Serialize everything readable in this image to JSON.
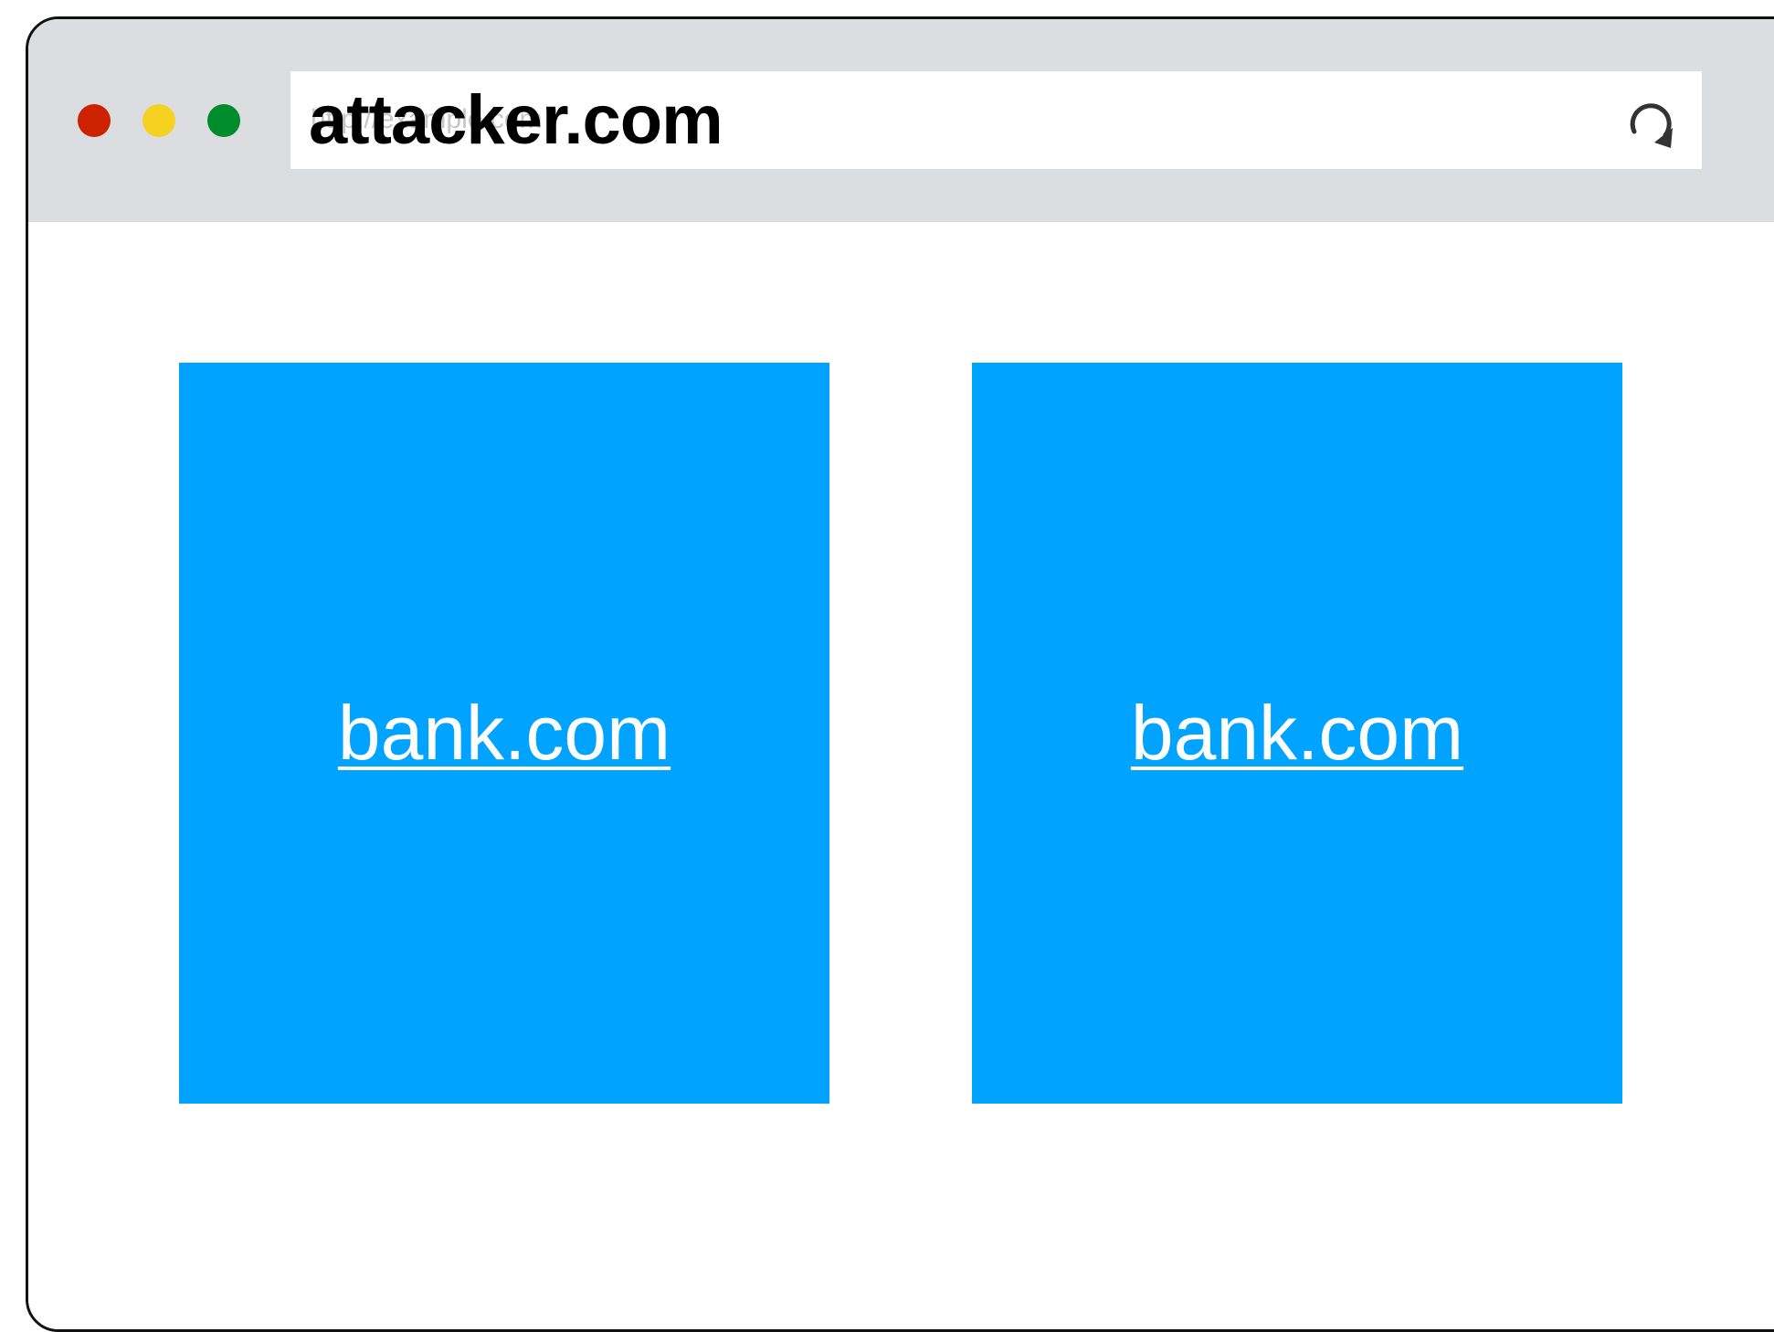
{
  "window": {
    "controls": [
      {
        "name": "close",
        "color": "#cc2200"
      },
      {
        "name": "minimize",
        "color": "#f5d222"
      },
      {
        "name": "maximize",
        "color": "#008c2c"
      }
    ]
  },
  "address_bar": {
    "url": "attacker.com",
    "faint_text": "http://example.com",
    "reload_icon": "reload-icon"
  },
  "colors": {
    "toolbar": "#dcdde0",
    "frame_background": "#00a3ff",
    "link": "#ffffff"
  },
  "frames": [
    {
      "link_text": "bank.com"
    },
    {
      "link_text": "bank.com"
    }
  ]
}
